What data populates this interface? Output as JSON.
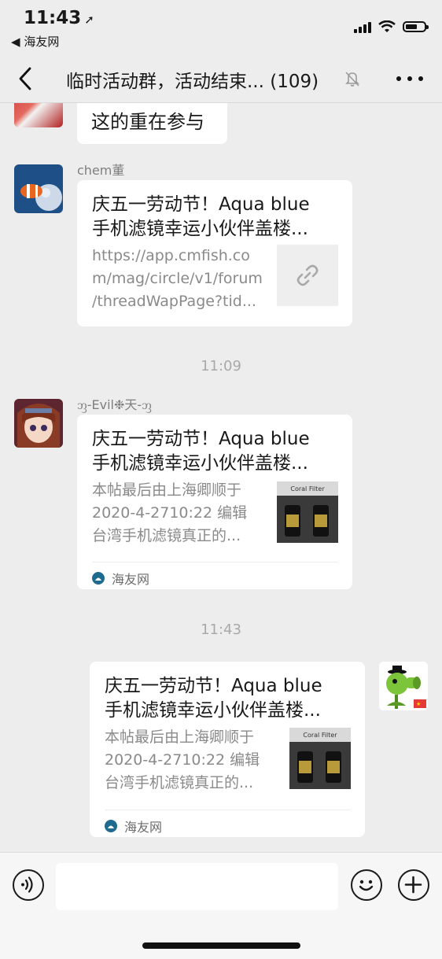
{
  "status_bar": {
    "time": "11:43",
    "back_app": "海友网"
  },
  "header": {
    "title": "临时活动群，活动结束... (109)"
  },
  "messages": {
    "m1": {
      "text": "这的重在参与"
    },
    "m2": {
      "sender": "chem董",
      "title_line1": "庆五一劳动节！Aqua blue",
      "title_line2": "手机滤镜幸运小伙伴盖楼...",
      "desc_line1": "https://app.cmfish.co",
      "desc_line2": "m/mag/circle/v1/forum",
      "desc_line3": "/threadWapPage?tid..."
    },
    "time1": "11:09",
    "m3": {
      "sender": "ᦀ-Evil❉天-ᦀ",
      "title_line1": "庆五一劳动节！Aqua blue",
      "title_line2": "手机滤镜幸运小伙伴盖楼...",
      "desc_line1": "本帖最后由上海卿顺于",
      "desc_line2": "2020-4-2710:22 编辑",
      "desc_line3": "台湾手机滤镜真正的...",
      "source": "海友网",
      "thumb_text": "Coral Filter"
    },
    "time2": "11:43",
    "m4": {
      "title_line1": "庆五一劳动节！Aqua blue",
      "title_line2": "手机滤镜幸运小伙伴盖楼...",
      "desc_line1": "本帖最后由上海卿顺于",
      "desc_line2": "2020-4-2710:22 编辑",
      "desc_line3": "台湾手机滤镜真正的...",
      "source": "海友网",
      "thumb_text": "Coral Filter"
    }
  },
  "input_bar": {
    "placeholder": ""
  },
  "icons": {
    "back": "chevron-left-icon",
    "mute": "bell-off-icon",
    "more": "more-icon",
    "voice": "voice-icon",
    "emoji": "emoji-icon",
    "plus": "plus-icon",
    "link": "link-icon"
  },
  "colors": {
    "background": "#ededed",
    "bubble": "#ffffff",
    "text_secondary": "#8a8a8a"
  }
}
